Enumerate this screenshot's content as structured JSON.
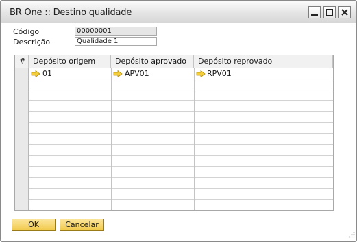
{
  "window": {
    "title": "BR One :: Destino qualidade",
    "controls": [
      "minimize-icon",
      "maximize-icon",
      "close-icon"
    ]
  },
  "form": {
    "codigo_label": "Código",
    "codigo_value": "00000001",
    "descricao_label": "Descrição",
    "descricao_value": "Qualidade 1"
  },
  "grid": {
    "columns": [
      "#",
      "Depósito origem",
      "Depósito aprovado",
      "Depósito reprovado"
    ],
    "rows": [
      {
        "origem": "01",
        "aprovado": "APV01",
        "reprovado": "RPV01"
      }
    ],
    "link_icon": "link-arrow-icon",
    "link_color": "#f0c020"
  },
  "buttons": {
    "ok_label": "OK",
    "cancel_label": "Cancelar"
  },
  "colors": {
    "button_yellow": "#f1c94a",
    "readonly_field": "#e6e6e6"
  }
}
